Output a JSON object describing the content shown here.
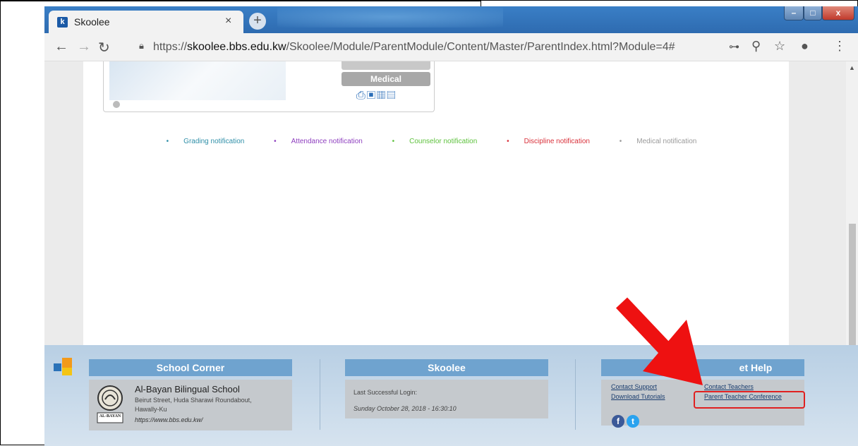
{
  "browser": {
    "tab_title": "Skoolee",
    "tab_favicon": "k",
    "tab_close": "×",
    "new_tab": "+",
    "url_prefix": "https://",
    "url_host": "skoolee.bbs.edu.kw",
    "url_path": "/Skoolee/Module/ParentModule/Content/Master/ParentIndex.html?Module=4#",
    "icons": [
      "back-icon",
      "forward-icon",
      "reload-icon",
      "lock-icon",
      "key-icon",
      "zoom-icon",
      "star-icon",
      "account-icon",
      "menu-icon"
    ]
  },
  "card": {
    "button_label": "Medical",
    "icons": [
      "printer-icon",
      "bus-icon",
      "calendar-grid-icon",
      "calendar-18-icon"
    ]
  },
  "legend": [
    {
      "label": "Grading notification",
      "color": "#2f8fa8"
    },
    {
      "label": "Attendance notification",
      "color": "#8e3fbf"
    },
    {
      "label": "Counselor notification",
      "color": "#5dc13c"
    },
    {
      "label": "Discipline notification",
      "color": "#d9303a"
    },
    {
      "label": "Medical notification",
      "color": "#9a9a9a"
    }
  ],
  "footer": {
    "school_corner": {
      "heading": "School Corner",
      "school_name": "Al-Bayan Bilingual School",
      "address_line1": "Beirut Street, Huda Sharawi Roundabout,",
      "address_line2": "Hawally-Ku",
      "website": "https://www.bbs.edu.kw/",
      "seal_text": "AL-BAYAN"
    },
    "skoolee": {
      "heading": "Skoolee",
      "login_label": "Last Successful Login:",
      "login_value": "Sunday October 28, 2018 - 16:30:10"
    },
    "get_help": {
      "heading": "et Help",
      "links": {
        "contact_support": "Contact Support",
        "download_tutorials": "Download Tutorials",
        "contact_teachers": "Contact Teachers",
        "parent_teacher_conference": "Parent Teacher Conference"
      },
      "social": {
        "facebook": "f",
        "twitter": "t"
      }
    }
  },
  "colors": {
    "footer_heading": "#6fa3cf",
    "highlight": "#e02020",
    "brand_blue": "#2a72b8",
    "brand_orange": "#f39a1a",
    "brand_yellow": "#f4c414"
  }
}
